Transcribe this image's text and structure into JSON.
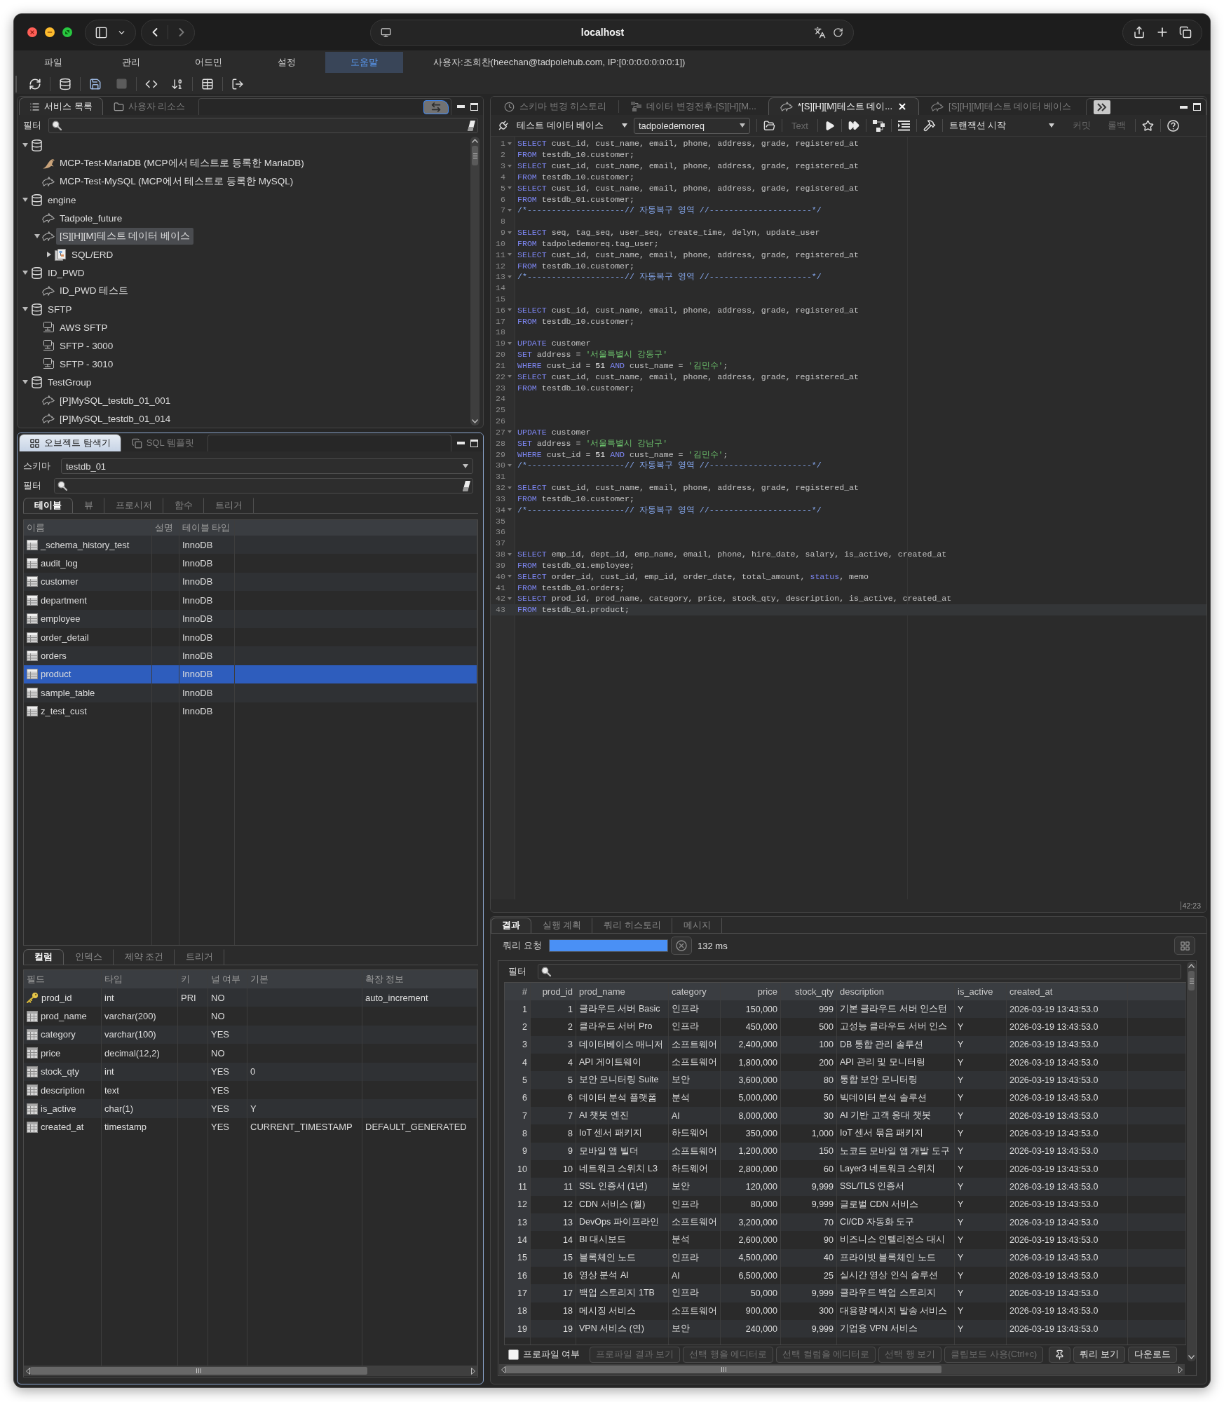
{
  "browser": {
    "address": "localhost"
  },
  "menu": {
    "items": [
      {
        "label": "파일",
        "selected": false
      },
      {
        "label": "관리",
        "selected": false
      },
      {
        "label": "어드민",
        "selected": false
      },
      {
        "label": "설정",
        "selected": false
      },
      {
        "label": "도움말",
        "selected": true
      }
    ],
    "user_info": "사용자:조희찬(heechan@tadpolehub.com, IP:[0:0:0:0:0:0:0:1])"
  },
  "toolbar": [
    [
      {
        "disabled": false
      }
    ],
    [
      {
        "disabled": false
      }
    ],
    [
      {
        "disabled": false
      },
      {
        "disabled": true
      }
    ],
    [
      {
        "disabled": false
      },
      {
        "disabled": false
      }
    ],
    [
      {
        "disabled": false
      }
    ],
    [
      {
        "disabled": false
      }
    ]
  ],
  "service_panel": {
    "tabs": [
      {
        "kind": "services",
        "label": "서비스 목록",
        "selected": true
      },
      {
        "kind": "resources",
        "label": "사용자 리소스",
        "selected": false
      }
    ],
    "filter_label": "필터",
    "tree": [
      {
        "kind": "group",
        "expanded": true,
        "selected": false,
        "children": [
          {
            "kind": "mariadb",
            "label": "MCP-Test-MariaDB (MCP에서 테스트로 등록한 MariaDB)",
            "selected": false
          },
          {
            "kind": "mysql",
            "label": "MCP-Test-MySQL (MCP에서 테스트로 등록한 MySQL)",
            "selected": false
          }
        ]
      },
      {
        "kind": "group",
        "label": "engine",
        "expanded": true,
        "selected": false,
        "children": [
          {
            "kind": "mysql",
            "label": "Tadpole_future",
            "selected": false
          },
          {
            "kind": "mysql",
            "label": "[S][H][M]테스트 데이터 베이스",
            "expanded": true,
            "selected": true,
            "children": [
              {
                "kind": "erd",
                "label": "SQL/ERD",
                "expanded": false,
                "selected": false
              }
            ]
          }
        ]
      },
      {
        "kind": "group",
        "label": "ID_PWD",
        "expanded": true,
        "selected": false,
        "children": [
          {
            "kind": "mysql",
            "label": "ID_PWD 테스트",
            "selected": false
          }
        ]
      },
      {
        "kind": "group",
        "label": "SFTP",
        "expanded": true,
        "selected": false,
        "children": [
          {
            "kind": "sftp",
            "label": "AWS SFTP",
            "selected": false
          },
          {
            "kind": "sftp",
            "label": "SFTP - 3000",
            "selected": false
          },
          {
            "kind": "sftp",
            "label": "SFTP - 3010",
            "selected": false
          }
        ]
      },
      {
        "kind": "group",
        "label": "TestGroup",
        "expanded": true,
        "selected": false,
        "children": [
          {
            "kind": "mysql",
            "label": "[P]MySQL_testdb_01_001",
            "selected": false
          },
          {
            "kind": "mysql",
            "label": "[P]MySQL_testdb_01_014",
            "selected": false
          }
        ]
      }
    ]
  },
  "object_panel": {
    "tabs": [
      {
        "kind": "explorer",
        "label": "오브젝트 탐색기",
        "selected": true
      },
      {
        "kind": "templates",
        "label": "SQL 템플릿",
        "selected": false
      }
    ],
    "schema_label": "스키마",
    "schema": "testdb_01",
    "filter_label": "필터",
    "object_tabs": [
      {
        "label": "테이블",
        "selected": true
      },
      {
        "label": "뷰",
        "selected": false
      },
      {
        "label": "프로시저",
        "selected": false
      },
      {
        "label": "함수",
        "selected": false
      },
      {
        "label": "트리거",
        "selected": false
      }
    ],
    "tables": {
      "columns": [
        "이름",
        "설명",
        "테이블 타입"
      ],
      "rows": [
        {
          "name": "_schema_history_test",
          "type": "InnoDB",
          "selected": false
        },
        {
          "name": "audit_log",
          "type": "InnoDB",
          "selected": false
        },
        {
          "name": "customer",
          "type": "InnoDB",
          "selected": false
        },
        {
          "name": "department",
          "type": "InnoDB",
          "selected": false
        },
        {
          "name": "employee",
          "type": "InnoDB",
          "selected": false
        },
        {
          "name": "order_detail",
          "type": "InnoDB",
          "selected": false
        },
        {
          "name": "orders",
          "type": "InnoDB",
          "selected": false
        },
        {
          "name": "product",
          "type": "InnoDB",
          "selected": true
        },
        {
          "name": "sample_table",
          "type": "InnoDB",
          "selected": false
        },
        {
          "name": "z_test_cust",
          "type": "InnoDB",
          "selected": false
        }
      ]
    },
    "detail_tabs": [
      {
        "label": "컬럼",
        "selected": true
      },
      {
        "label": "인덱스",
        "selected": false
      },
      {
        "label": "제약 조건",
        "selected": false
      },
      {
        "label": "트리거",
        "selected": false
      }
    ],
    "columns": {
      "headers": [
        "필드",
        "타입",
        "키",
        "널 여부",
        "기본",
        "확장 정보"
      ],
      "rows": [
        {
          "kind": "primary",
          "field": "prod_id",
          "type": "int",
          "key": "PRI",
          "nullable": "NO",
          "extra": "auto_increment"
        },
        {
          "kind": "column",
          "field": "prod_name",
          "type": "varchar(200)",
          "nullable": "NO"
        },
        {
          "kind": "column",
          "field": "category",
          "type": "varchar(100)",
          "nullable": "YES"
        },
        {
          "kind": "column",
          "field": "price",
          "type": "decimal(12,2)",
          "nullable": "NO"
        },
        {
          "kind": "column",
          "field": "stock_qty",
          "type": "int",
          "nullable": "YES",
          "default": "0"
        },
        {
          "kind": "column",
          "field": "description",
          "type": "text",
          "nullable": "YES"
        },
        {
          "kind": "column",
          "field": "is_active",
          "type": "char(1)",
          "nullable": "YES",
          "default": "Y"
        },
        {
          "kind": "column",
          "field": "created_at",
          "type": "timestamp",
          "nullable": "YES",
          "default": "CURRENT_TIMESTAMP",
          "extra": "DEFAULT_GENERATED"
        }
      ]
    }
  },
  "editor_panel": {
    "tabs": [
      {
        "kind": "history",
        "label": "스키마 변경 히스토리",
        "selected": false
      },
      {
        "kind": "diff",
        "label": "데이터 변경전후-[S][H][M...",
        "selected": false
      },
      {
        "kind": "editor",
        "label": "*[S][H][M]테스트 데이...",
        "selected": true
      },
      {
        "kind": "editor",
        "label": "[S][H][M]테스트 데이터 베이스",
        "selected": false
      }
    ],
    "toolbar": {
      "connection": "테스트 데이터 베이스",
      "database": "tadpoledemoreq",
      "text_button": {
        "label": "Text",
        "disabled": true
      },
      "transaction": "트랜잭션 시작",
      "commit": {
        "label": "커밋",
        "disabled": true
      },
      "rollback": {
        "label": "롤백",
        "disabled": true
      }
    },
    "lines": [
      {
        "no": "1",
        "fold": true,
        "current": false,
        "tokens": [
          {
            "kind": "kw",
            "text": "SELECT"
          },
          {
            "kind": "id",
            "text": " cust_id, cust_name, email, phone, address, grade, registered_at"
          }
        ]
      },
      {
        "no": "2",
        "fold": false,
        "current": false,
        "tokens": [
          {
            "kind": "kw",
            "text": "FROM"
          },
          {
            "kind": "id",
            "text": " testdb_10.customer;"
          }
        ]
      },
      {
        "no": "3",
        "fold": true,
        "current": false,
        "tokens": [
          {
            "kind": "kw",
            "text": "SELECT"
          },
          {
            "kind": "id",
            "text": " cust_id, cust_name, email, phone, address, grade, registered_at"
          }
        ]
      },
      {
        "no": "4",
        "fold": false,
        "current": false,
        "tokens": [
          {
            "kind": "kw",
            "text": "FROM"
          },
          {
            "kind": "id",
            "text": " testdb_10.customer;"
          }
        ]
      },
      {
        "no": "5",
        "fold": true,
        "current": false,
        "tokens": [
          {
            "kind": "kw",
            "text": "SELECT"
          },
          {
            "kind": "id",
            "text": " cust_id, cust_name, email, phone, address, grade, registered_at"
          }
        ]
      },
      {
        "no": "6",
        "fold": false,
        "current": false,
        "tokens": [
          {
            "kind": "kw",
            "text": "FROM"
          },
          {
            "kind": "id",
            "text": " testdb_01.customer;"
          }
        ]
      },
      {
        "no": "7",
        "fold": true,
        "current": false,
        "tokens": [
          {
            "kind": "cmt",
            "text": "/*--------------------// 자동복구 영역 //---------------------*/"
          }
        ]
      },
      {
        "no": "8",
        "fold": false,
        "current": false
      },
      {
        "no": "9",
        "fold": true,
        "current": false,
        "tokens": [
          {
            "kind": "kw",
            "text": "SELECT"
          },
          {
            "kind": "id",
            "text": " seq, tag_seq, user_seq, create_time, delyn, update_user"
          }
        ]
      },
      {
        "no": "10",
        "fold": false,
        "current": false,
        "tokens": [
          {
            "kind": "kw",
            "text": "FROM"
          },
          {
            "kind": "id",
            "text": " tadpoledemoreq.tag_user;"
          }
        ]
      },
      {
        "no": "11",
        "fold": true,
        "current": false,
        "tokens": [
          {
            "kind": "kw",
            "text": "SELECT"
          },
          {
            "kind": "id",
            "text": " cust_id, cust_name, email, phone, address, grade, registered_at"
          }
        ]
      },
      {
        "no": "12",
        "fold": false,
        "current": false,
        "tokens": [
          {
            "kind": "kw",
            "text": "FROM"
          },
          {
            "kind": "id",
            "text": " testdb_10.customer;"
          }
        ]
      },
      {
        "no": "13",
        "fold": true,
        "current": false,
        "tokens": [
          {
            "kind": "cmt",
            "text": "/*--------------------// 자동복구 영역 //---------------------*/"
          }
        ]
      },
      {
        "no": "14",
        "fold": false,
        "current": false
      },
      {
        "no": "15",
        "fold": false,
        "current": false
      },
      {
        "no": "16",
        "fold": true,
        "current": false,
        "tokens": [
          {
            "kind": "kw",
            "text": "SELECT"
          },
          {
            "kind": "id",
            "text": " cust_id, cust_name, email, phone, address, grade, registered_at"
          }
        ]
      },
      {
        "no": "17",
        "fold": false,
        "current": false,
        "tokens": [
          {
            "kind": "kw",
            "text": "FROM"
          },
          {
            "kind": "id",
            "text": " testdb_10.customer;"
          }
        ]
      },
      {
        "no": "18",
        "fold": false,
        "current": false
      },
      {
        "no": "19",
        "fold": true,
        "current": false,
        "tokens": [
          {
            "kind": "kw",
            "text": "UPDATE"
          },
          {
            "kind": "id",
            "text": " customer"
          }
        ]
      },
      {
        "no": "20",
        "fold": false,
        "current": false,
        "tokens": [
          {
            "kind": "kw",
            "text": "SET"
          },
          {
            "kind": "id",
            "text": " address = "
          },
          {
            "kind": "str",
            "text": "'서울특별시 강동구'"
          }
        ]
      },
      {
        "no": "21",
        "fold": false,
        "current": false,
        "tokens": [
          {
            "kind": "kw",
            "text": "WHERE"
          },
          {
            "kind": "id",
            "text": " cust_id = "
          },
          {
            "kind": "num",
            "text": "51"
          },
          {
            "kind": "kw",
            "text": " AND"
          },
          {
            "kind": "id",
            "text": " cust_name = "
          },
          {
            "kind": "str",
            "text": "'김민수'"
          },
          {
            "kind": "id",
            "text": ";"
          }
        ]
      },
      {
        "no": "22",
        "fold": true,
        "current": false,
        "tokens": [
          {
            "kind": "kw",
            "text": "SELECT"
          },
          {
            "kind": "id",
            "text": " cust_id, cust_name, email, phone, address, grade, registered_at"
          }
        ]
      },
      {
        "no": "23",
        "fold": false,
        "current": false,
        "tokens": [
          {
            "kind": "kw",
            "text": "FROM"
          },
          {
            "kind": "id",
            "text": " testdb_10.customer;"
          }
        ]
      },
      {
        "no": "24",
        "fold": false,
        "current": false
      },
      {
        "no": "25",
        "fold": false,
        "current": false
      },
      {
        "no": "26",
        "fold": false,
        "current": false
      },
      {
        "no": "27",
        "fold": true,
        "current": false,
        "tokens": [
          {
            "kind": "kw",
            "text": "UPDATE"
          },
          {
            "kind": "id",
            "text": " customer"
          }
        ]
      },
      {
        "no": "28",
        "fold": false,
        "current": false,
        "tokens": [
          {
            "kind": "kw",
            "text": "SET"
          },
          {
            "kind": "id",
            "text": " address = "
          },
          {
            "kind": "str",
            "text": "'서울특별시 강남구'"
          }
        ]
      },
      {
        "no": "29",
        "fold": false,
        "current": false,
        "tokens": [
          {
            "kind": "kw",
            "text": "WHERE"
          },
          {
            "kind": "id",
            "text": " cust_id = "
          },
          {
            "kind": "num",
            "text": "51"
          },
          {
            "kind": "kw",
            "text": " AND"
          },
          {
            "kind": "id",
            "text": " cust_name = "
          },
          {
            "kind": "str",
            "text": "'김민수'"
          },
          {
            "kind": "id",
            "text": ";"
          }
        ]
      },
      {
        "no": "30",
        "fold": true,
        "current": false,
        "tokens": [
          {
            "kind": "cmt",
            "text": "/*--------------------// 자동복구 영역 //---------------------*/"
          }
        ]
      },
      {
        "no": "31",
        "fold": false,
        "current": false
      },
      {
        "no": "32",
        "fold": true,
        "current": false,
        "tokens": [
          {
            "kind": "kw",
            "text": "SELECT"
          },
          {
            "kind": "id",
            "text": " cust_id, cust_name, email, phone, address, grade, registered_at"
          }
        ]
      },
      {
        "no": "33",
        "fold": false,
        "current": false,
        "tokens": [
          {
            "kind": "kw",
            "text": "FROM"
          },
          {
            "kind": "id",
            "text": " testdb_10.customer;"
          }
        ]
      },
      {
        "no": "34",
        "fold": true,
        "current": false,
        "tokens": [
          {
            "kind": "cmt",
            "text": "/*--------------------// 자동복구 영역 //---------------------*/"
          }
        ]
      },
      {
        "no": "35",
        "fold": false,
        "current": false
      },
      {
        "no": "36",
        "fold": false,
        "current": false
      },
      {
        "no": "37",
        "fold": false,
        "current": false
      },
      {
        "no": "38",
        "fold": true,
        "current": false,
        "tokens": [
          {
            "kind": "kw",
            "text": "SELECT"
          },
          {
            "kind": "id",
            "text": " emp_id, dept_id, emp_name, email, phone, hire_date, salary, is_active, created_at"
          }
        ]
      },
      {
        "no": "39",
        "fold": false,
        "current": false,
        "tokens": [
          {
            "kind": "kw",
            "text": "FROM"
          },
          {
            "kind": "id",
            "text": " testdb_01.employee;"
          }
        ]
      },
      {
        "no": "40",
        "fold": true,
        "current": false,
        "tokens": [
          {
            "kind": "kw",
            "text": "SELECT"
          },
          {
            "kind": "id",
            "text": " order_id, cust_id, emp_id, order_date, total_amount, "
          },
          {
            "kind": "kw",
            "text": "status"
          },
          {
            "kind": "id",
            "text": ", memo"
          }
        ]
      },
      {
        "no": "41",
        "fold": false,
        "current": false,
        "tokens": [
          {
            "kind": "kw",
            "text": "FROM"
          },
          {
            "kind": "id",
            "text": " testdb_01.orders;"
          }
        ]
      },
      {
        "no": "42",
        "fold": true,
        "current": false,
        "tokens": [
          {
            "kind": "kw",
            "text": "SELECT"
          },
          {
            "kind": "id",
            "text": " prod_id, prod_name, category, price, stock_qty, description, is_active, created_at"
          }
        ]
      },
      {
        "no": "43",
        "fold": false,
        "current": true,
        "tokens": [
          {
            "kind": "kw",
            "text": "FROM"
          },
          {
            "kind": "id",
            "text": " testdb_01.product;"
          }
        ]
      }
    ],
    "cursor": "42:23"
  },
  "results": {
    "tabs": [
      {
        "label": "결과",
        "selected": true
      },
      {
        "label": "실행 계획",
        "selected": false
      },
      {
        "label": "쿼리 히스토리",
        "selected": false
      },
      {
        "label": "메시지",
        "selected": false
      }
    ],
    "request_label": "쿼리 요청",
    "progress": {
      "level": 1
    },
    "elapsed": "132 ms",
    "filter_label": "필터",
    "table": {
      "columns": [
        "#",
        "prod_id",
        "prod_name",
        "category",
        "price",
        "stock_qty",
        "description",
        "is_active",
        "created_at"
      ],
      "rows": [
        [
          "1",
          "1",
          "클라우드 서버 Basic",
          "인프라",
          "150,000",
          "999",
          "기본 클라우드 서버 인스턴",
          "Y",
          "2026-03-19 13:43:53.0"
        ],
        [
          "2",
          "2",
          "클라우드 서버 Pro",
          "인프라",
          "450,000",
          "500",
          "고성능 클라우드 서버 인스",
          "Y",
          "2026-03-19 13:43:53.0"
        ],
        [
          "3",
          "3",
          "데이터베이스 매니저",
          "소프트웨어",
          "2,400,000",
          "100",
          "DB 통합 관리 솔루션",
          "Y",
          "2026-03-19 13:43:53.0"
        ],
        [
          "4",
          "4",
          "API 게이트웨이",
          "소프트웨어",
          "1,800,000",
          "200",
          "API 관리 및 모니터링",
          "Y",
          "2026-03-19 13:43:53.0"
        ],
        [
          "5",
          "5",
          "보안 모니터링 Suite",
          "보안",
          "3,600,000",
          "80",
          "통합 보안 모니터링",
          "Y",
          "2026-03-19 13:43:53.0"
        ],
        [
          "6",
          "6",
          "데이터 분석 플랫폼",
          "분석",
          "5,000,000",
          "50",
          "빅데이터 분석 솔루션",
          "Y",
          "2026-03-19 13:43:53.0"
        ],
        [
          "7",
          "7",
          "AI 챗봇 엔진",
          "AI",
          "8,000,000",
          "30",
          "AI 기반 고객 응대 챗봇",
          "Y",
          "2026-03-19 13:43:53.0"
        ],
        [
          "8",
          "8",
          "IoT 센서 패키지",
          "하드웨어",
          "350,000",
          "1,000",
          "IoT 센서 묶음 패키지",
          "Y",
          "2026-03-19 13:43:53.0"
        ],
        [
          "9",
          "9",
          "모바일 앱 빌더",
          "소프트웨어",
          "1,200,000",
          "150",
          "노코드 모바일 앱 개발 도구",
          "Y",
          "2026-03-19 13:43:53.0"
        ],
        [
          "10",
          "10",
          "네트워크 스위치 L3",
          "하드웨어",
          "2,800,000",
          "60",
          "Layer3 네트워크 스위치",
          "Y",
          "2026-03-19 13:43:53.0"
        ],
        [
          "11",
          "11",
          "SSL 인증서 (1년)",
          "보안",
          "120,000",
          "9,999",
          "SSL/TLS 인증서",
          "Y",
          "2026-03-19 13:43:53.0"
        ],
        [
          "12",
          "12",
          "CDN 서비스 (월)",
          "인프라",
          "80,000",
          "9,999",
          "글로벌 CDN 서비스",
          "Y",
          "2026-03-19 13:43:53.0"
        ],
        [
          "13",
          "13",
          "DevOps 파이프라인",
          "소프트웨어",
          "3,200,000",
          "70",
          "CI/CD 자동화 도구",
          "Y",
          "2026-03-19 13:43:53.0"
        ],
        [
          "14",
          "14",
          "BI 대시보드",
          "분석",
          "2,600,000",
          "90",
          "비즈니스 인텔리전스 대시",
          "Y",
          "2026-03-19 13:43:53.0"
        ],
        [
          "15",
          "15",
          "블록체인 노드",
          "인프라",
          "4,500,000",
          "40",
          "프라이빗 블록체인 노드",
          "Y",
          "2026-03-19 13:43:53.0"
        ],
        [
          "16",
          "16",
          "영상 분석 AI",
          "AI",
          "6,500,000",
          "25",
          "실시간 영상 인식 솔루션",
          "Y",
          "2026-03-19 13:43:53.0"
        ],
        [
          "17",
          "17",
          "백업 스토리지 1TB",
          "인프라",
          "50,000",
          "9,999",
          "클라우드 백업 스토리지",
          "Y",
          "2026-03-19 13:43:53.0"
        ],
        [
          "18",
          "18",
          "메시징 서비스",
          "소프트웨어",
          "900,000",
          "300",
          "대용량 메시지 발송 서비스",
          "Y",
          "2026-03-19 13:43:53.0"
        ],
        [
          "19",
          "19",
          "VPN 서비스 (연)",
          "보안",
          "240,000",
          "9,999",
          "기업용 VPN 서비스",
          "Y",
          "2026-03-19 13:43:53.0"
        ]
      ]
    },
    "profile": {
      "label": "프로파일 여부",
      "checked": false
    },
    "actions": [
      {
        "kind": "text",
        "label": "프로파일 결과 보기",
        "disabled": true
      },
      {
        "kind": "text",
        "label": "선택 행을 에디터로",
        "disabled": true
      },
      {
        "kind": "text",
        "label": "선택 컬럼을 에디터로",
        "disabled": true
      },
      {
        "kind": "text",
        "label": "선택 행 보기",
        "disabled": true
      },
      {
        "kind": "text",
        "label": "클립보드 사용(Ctrl+c)",
        "disabled": true
      },
      {
        "kind": "pin",
        "disabled": false
      },
      {
        "kind": "text",
        "label": "쿼리 보기",
        "disabled": false
      },
      {
        "kind": "text",
        "label": "다운로드",
        "disabled": false
      }
    ]
  }
}
